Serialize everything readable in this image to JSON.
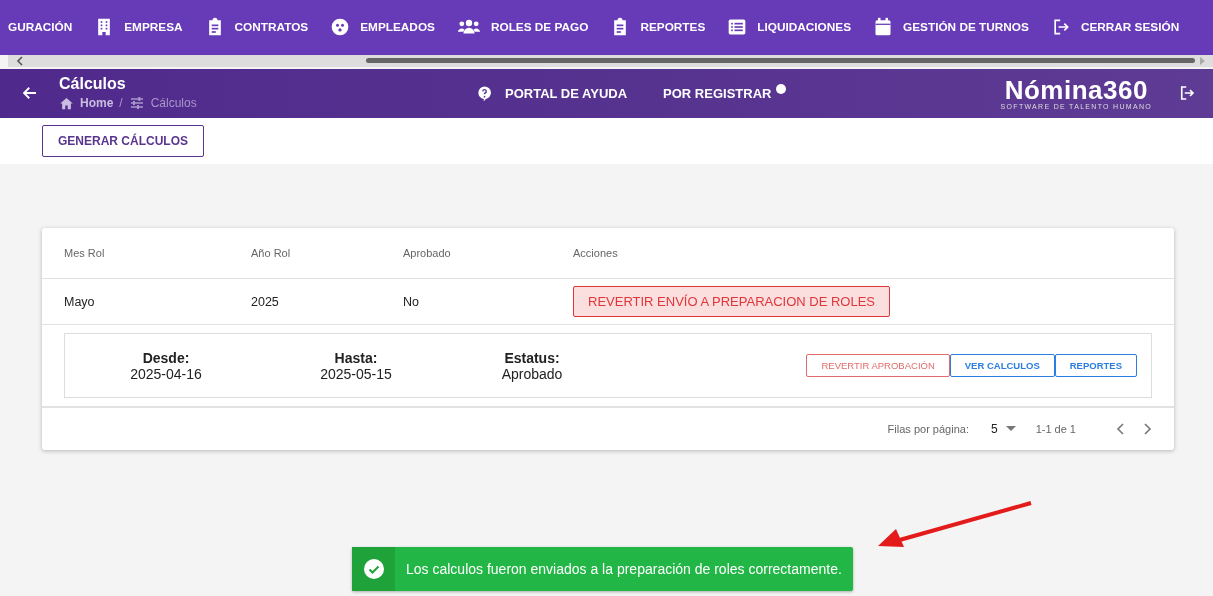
{
  "nav": {
    "items": [
      {
        "label": "GURACIÓN",
        "kind": "none"
      },
      {
        "label": "EMPRESA",
        "kind": "building"
      },
      {
        "label": "CONTRATOS",
        "kind": "clipboard"
      },
      {
        "label": "EMPLEADOS",
        "kind": "face"
      },
      {
        "label": "ROLES DE PAGO",
        "kind": "people"
      },
      {
        "label": "REPORTES",
        "kind": "clipboard"
      },
      {
        "label": "LIQUIDACIONES",
        "kind": "list"
      },
      {
        "label": "GESTIÓN DE TURNOS",
        "kind": "calendar"
      },
      {
        "label": "CERRAR SESIÓN",
        "kind": "logout"
      }
    ]
  },
  "header": {
    "title": "Cálculos",
    "breadcrumb": [
      "Home",
      "/",
      "Cálculos"
    ],
    "help": "PORTAL DE AYUDA",
    "pending": "POR REGISTRAR",
    "logo": "Nómina360",
    "tagline": "SOFTWARE DE TALENTO HUMANO"
  },
  "toolbar": {
    "button": "GENERAR CÁLCULOS"
  },
  "table": {
    "columns": [
      "Mes Rol",
      "Año Rol",
      "Aprobado",
      "Acciones"
    ],
    "rows": [
      {
        "cells": [
          "Mayo",
          "2025",
          "No"
        ],
        "action": "REVERTIR ENVÍO A PREPARACION DE ROLES",
        "detail": {
          "fields": [
            {
              "label": "Desde:",
              "value": "2025-04-16"
            },
            {
              "label": "Hasta:",
              "value": "2025-05-15"
            },
            {
              "label": "Estatus:",
              "value": "Aprobado"
            }
          ],
          "buttons": [
            {
              "label": "REVERTIR APROBACIÓN",
              "kind": "danger"
            },
            {
              "label": "VER CALCULOS",
              "kind": "primary"
            },
            {
              "label": "REPORTES",
              "kind": "primary"
            }
          ]
        }
      }
    ],
    "footer": {
      "rows_label": "Filas por página:",
      "rows_value": "5",
      "range": "1-1 de 1"
    }
  },
  "toast": {
    "message": "Los calculos fueron enviados a la preparación de roles correctamente."
  }
}
